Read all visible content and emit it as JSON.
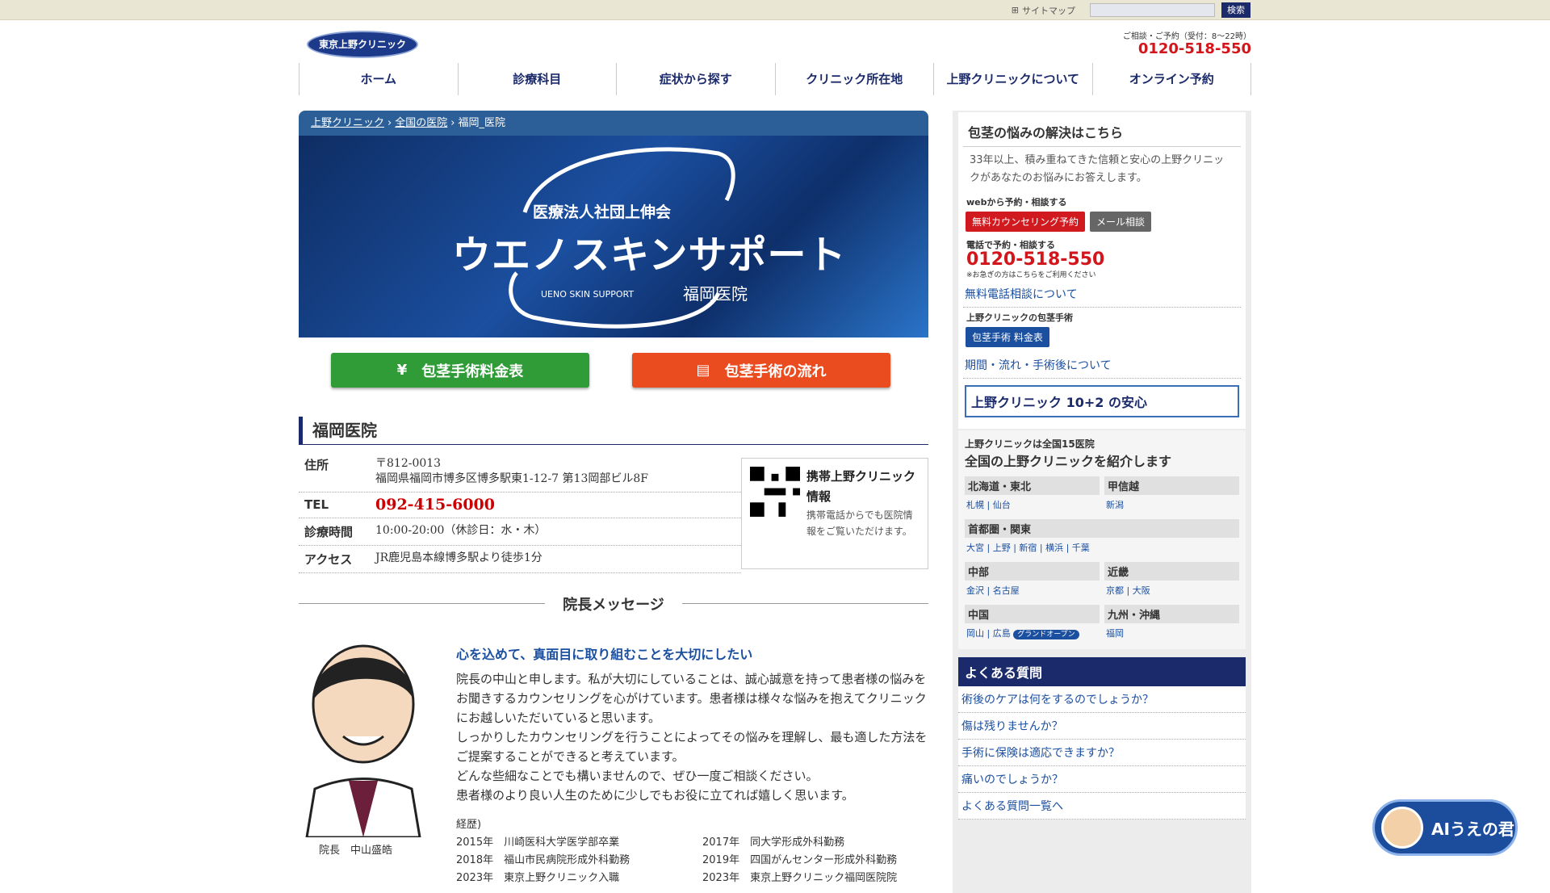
{
  "topbar": {
    "sitemap": "サイトマップ",
    "search_button": "検索"
  },
  "header": {
    "logo": "東京上野クリニック",
    "contact_small": "ご相談・ご予約（受付：8〜22時）",
    "phone": "0120-518-550"
  },
  "nav": [
    "ホーム",
    "診療科目",
    "症状から探す",
    "クリニック所在地",
    "上野クリニックについて",
    "オンライン予約"
  ],
  "breadcrumb": [
    "上野クリニック",
    "全国の医院",
    "福岡_医院"
  ],
  "hero": {
    "org": "医療法人社団上伸会",
    "name": "ウエノスキンサポート",
    "eng": "UENO SKIN SUPPORT",
    "branch": "福岡医院"
  },
  "buttons": {
    "price": "包茎手術料金表",
    "flow": "包茎手術の流れ"
  },
  "clinic": {
    "title": "福岡医院",
    "address_label": "住所",
    "zip": "〒812-0013",
    "address": "福岡県福岡市博多区博多駅東1-12-7 第13岡部ビル8F",
    "tel_label": "TEL",
    "tel": "092-415-6000",
    "hours_label": "診療時間",
    "hours": "10:00-20:00（休診日：水・木）",
    "access_label": "アクセス",
    "access": "JR鹿児島本線博多駅より徒歩1分"
  },
  "mobile": {
    "title": "携帯上野クリニック情報",
    "desc": "携帯電話からでも医院情報をご覧いただけます。"
  },
  "message": {
    "heading": "院長メッセージ",
    "lead": "心を込めて、真面目に取り組むことを大切にしたい",
    "lines": [
      "院長の中山と申します。私が大切にしていることは、誠心誠意を持って患者様の悩みをお聞きするカウンセリングを心がけています。患者様は様々な悩みを抱えてクリニックにお越しいただいていると思います。",
      "しっかりしたカウンセリングを行うことによってその悩みを理解し、最も適した方法をご提案することができると考えています。",
      "どんな些細なことでも構いませんので、ぜひ一度ご相談ください。",
      "患者様のより良い人生のために少しでもお役に立てれば嬉しく思います。"
    ],
    "caption": "院長　中山盛皓",
    "career_label": "経歴)",
    "career": [
      "2015年　川崎医科大学医学部卒業",
      "2017年　同大学形成外科勤務",
      "2018年　福山市民病院形成外科勤務",
      "2019年　四国がんセンター形成外科勤務",
      "2023年　東京上野クリニック入職",
      "2023年　東京上野クリニック福岡医院院"
    ]
  },
  "side": {
    "title": "包茎の悩みの解決はこちら",
    "intro": "33年以上、積み重ねてきた信頼と安心の上野クリニックがあなたのお悩みにお答えします。",
    "web_label": "webから予約・相談する",
    "counsel_btn": "無料カウンセリング予約",
    "mail_btn": "メール相談",
    "phone_label": "電話で予約・相談する",
    "phone": "0120-518-550",
    "phone_note": "※お急ぎの方はこちらをご利用ください",
    "free_call": "無料電話相談について",
    "surgery_label": "上野クリニックの包茎手術",
    "price_btn": "包茎手術 料金表",
    "period": "期間・流れ・手術後について",
    "anshin": "上野クリニック 10+2 の安心",
    "area_small": "上野クリニックは全国15医院",
    "area_big": "全国の上野クリニックを紹介します",
    "regions": [
      {
        "name": "北海道・東北",
        "cities": "札幌 | 仙台"
      },
      {
        "name": "甲信越",
        "cities": "新潟"
      },
      {
        "name": "首都圏・関東",
        "cities": "大宮 | 上野 | 新宿 | 横浜 | 千葉"
      },
      {
        "name": "中部",
        "cities": "金沢 | 名古屋"
      },
      {
        "name": "近畿",
        "cities": "京都 | 大阪"
      },
      {
        "name": "中国",
        "cities": "岡山 | 広島"
      },
      {
        "name": "九州・沖縄",
        "cities": "福岡"
      }
    ],
    "grand_open": "グランドオープン",
    "faq_title": "よくある質問",
    "faq": [
      "術後のケアは何をするのでしょうか？",
      "傷は残りませんか？",
      "手術に保険は適応できますか？",
      "痛いのでしょうか？"
    ],
    "faq_more": "よくある質問一覧へ"
  },
  "ai_label": "AIうえの君"
}
